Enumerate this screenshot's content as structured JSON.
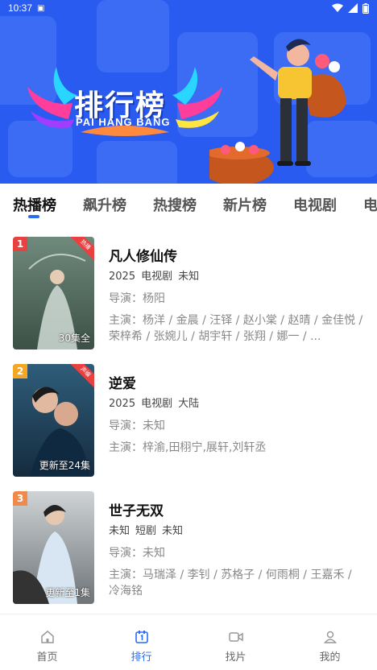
{
  "status_bar": {
    "time": "10:37"
  },
  "banner": {
    "title": "排行榜",
    "subtitle": "PAI HANG BANG"
  },
  "tabs": [
    {
      "label": "热播榜",
      "active": true
    },
    {
      "label": "飙升榜",
      "active": false
    },
    {
      "label": "热搜榜",
      "active": false
    },
    {
      "label": "新片榜",
      "active": false
    },
    {
      "label": "电视剧",
      "active": false
    },
    {
      "label": "电影",
      "active": false
    }
  ],
  "items": [
    {
      "rank": "1",
      "rank_color": "#e94040",
      "badge": "热播",
      "poster_colors": [
        "#6f8a7c",
        "#3c5046"
      ],
      "episodes": "30集全",
      "title": "凡人修仙传",
      "year": "2025",
      "type": "电视剧",
      "region": "未知",
      "director": "导演：杨阳",
      "cast": "主演：杨洋 / 金晨 / 汪铎 / 赵小棠 / 赵晴 / 金佳悦 / 荣梓希 / 张婉儿 / 胡宇轩 / 张翔 / 娜一 / ..."
    },
    {
      "rank": "2",
      "rank_color": "#f5a623",
      "badge": "声编",
      "poster_colors": [
        "#2f5d7a",
        "#152b3e"
      ],
      "episodes": "更新至24集",
      "title": "逆爱",
      "year": "2025",
      "type": "电视剧",
      "region": "大陆",
      "director": "导演：未知",
      "cast": "主演：梓渝,田栩宁,展轩,刘轩丞"
    },
    {
      "rank": "3",
      "rank_color": "#f08a4b",
      "badge": "",
      "poster_colors": [
        "#cfd3d6",
        "#6e7478"
      ],
      "episodes": "更新至1集",
      "title": "世子无双",
      "year": "未知",
      "type": "短剧",
      "region": "未知",
      "director": "导演：未知",
      "cast": "主演：马瑞泽 / 李钊 / 苏格子 / 何雨桐 / 王嘉禾 / 冷海铭"
    }
  ],
  "bottom_nav": [
    {
      "label": "首页",
      "icon": "home-icon",
      "active": false
    },
    {
      "label": "排行",
      "icon": "ranking-icon",
      "active": true
    },
    {
      "label": "找片",
      "icon": "video-camera-icon",
      "active": false
    },
    {
      "label": "我的",
      "icon": "user-icon",
      "active": false
    }
  ],
  "colors": {
    "accent": "#2a6cf6",
    "banner_bg": "#2a5bf0"
  }
}
